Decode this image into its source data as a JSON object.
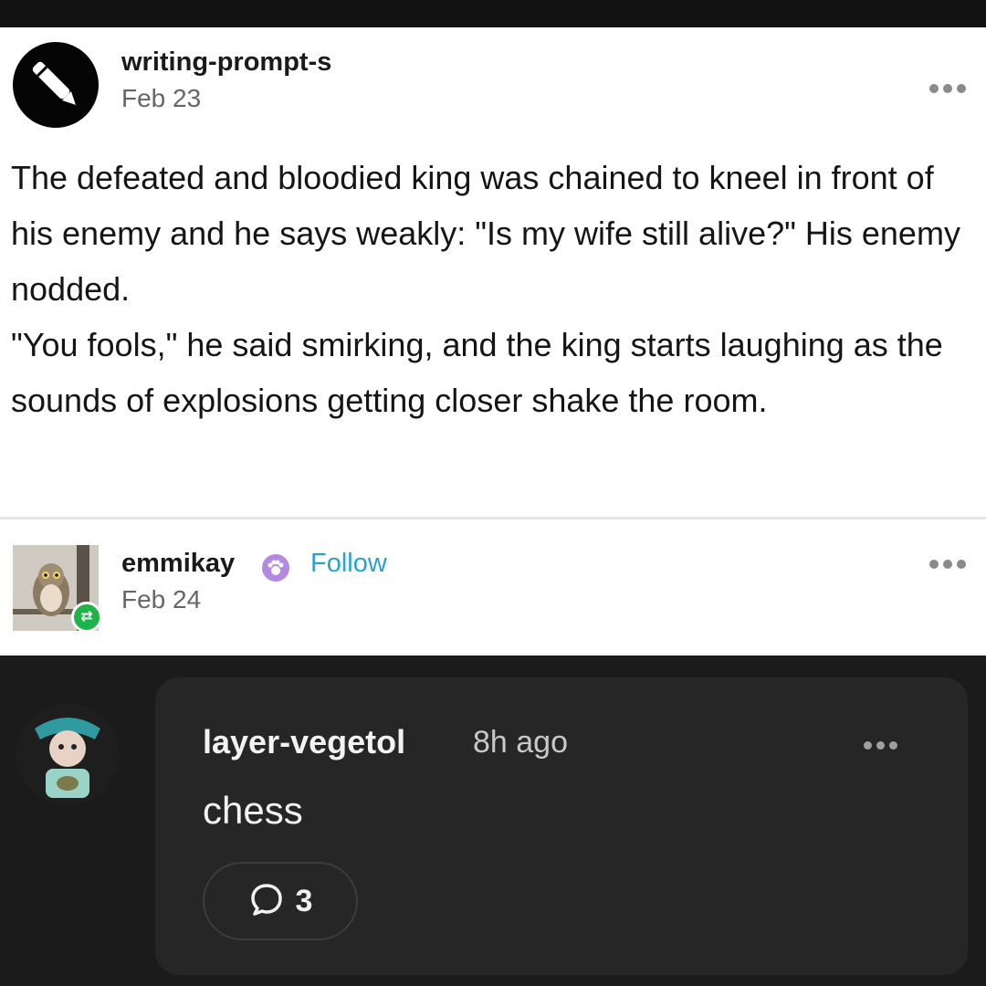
{
  "post": {
    "username": "writing-prompt-s",
    "date": "Feb 23",
    "avatar_icon": "pen-icon",
    "body_lines": [
      "The defeated and bloodied king was chained to kneel in front of his enemy and he says weakly: \"Is my wife still alive?\" His enemy nodded.",
      "\"You fools,\" he said smirking, and the king starts laughing as the sounds of explosions getting closer shake the room."
    ]
  },
  "reblog": {
    "username": "emmikay",
    "follow_label": "Follow",
    "date": "Feb 24",
    "badge_icon": "paw-badge-icon",
    "reblog_icon": "reblog-icon",
    "follow_color": "#2aa3c9",
    "reblog_color": "#1fb34a"
  },
  "reply": {
    "username": "layer-vegetol",
    "time": "8h ago",
    "text": "chess",
    "reply_count": "3",
    "reply_icon": "speech-bubble-icon"
  }
}
